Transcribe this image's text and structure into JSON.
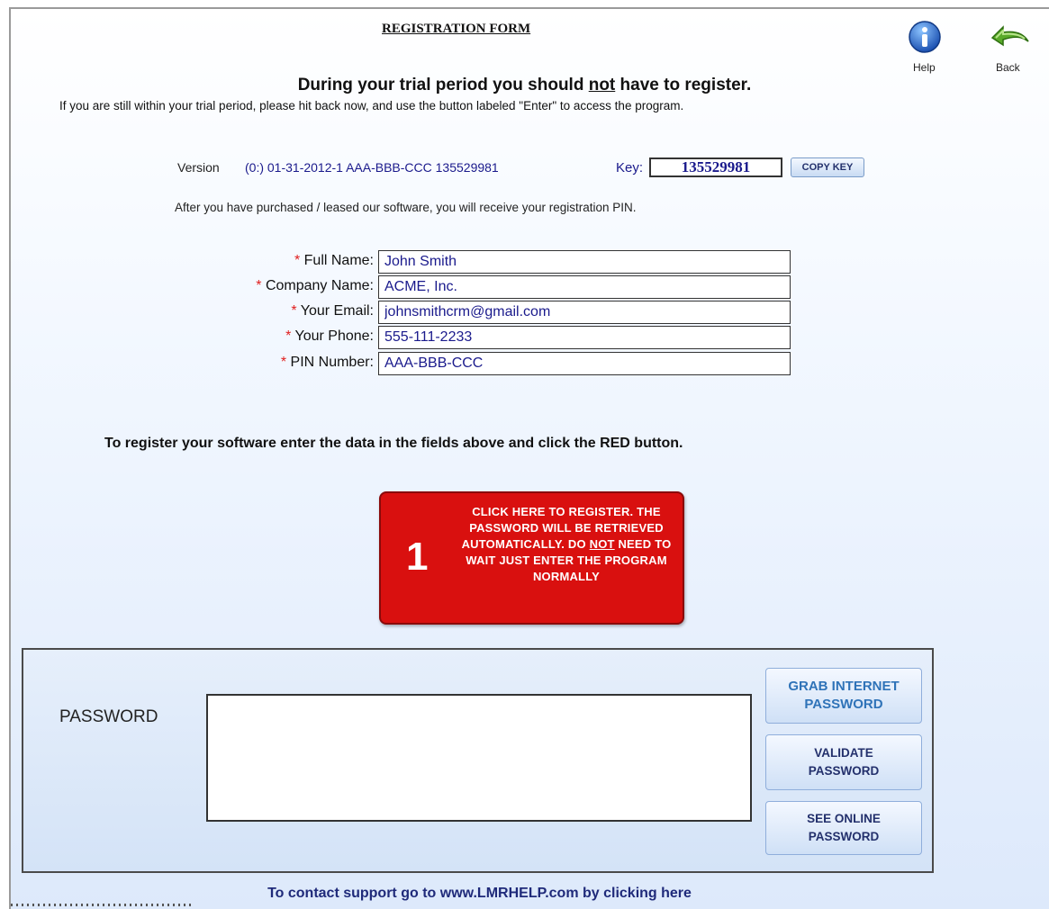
{
  "header": {
    "title": "REGISTRATION FORM",
    "help_label": "Help",
    "back_label": "Back",
    "help_icon": "info-circle-icon",
    "back_icon": "back-arrow-icon"
  },
  "intro": {
    "headline_pre": "During your trial period you should ",
    "headline_emph": "not",
    "headline_post": " have to register.",
    "subline": "If you are still within your trial period, please hit back now, and use the button labeled \"Enter\" to access the program."
  },
  "version": {
    "label": "Version",
    "value": "(0:) 01-31-2012-1 AAA-BBB-CCC 135529981",
    "key_label": "Key:",
    "key_value": "135529981",
    "copy_button": "COPY KEY"
  },
  "after_text": "After you have purchased / leased our software, you will receive your registration PIN.",
  "form": {
    "required_marker": "*",
    "fields": [
      {
        "label": "Full Name:",
        "value": "John Smith"
      },
      {
        "label": "Company Name:",
        "value": "ACME, Inc."
      },
      {
        "label": "Your Email:",
        "value": "johnsmithcrm@gmail.com"
      },
      {
        "label": "Your Phone:",
        "value": "555-111-2233"
      },
      {
        "label": "PIN Number:",
        "value": "AAA-BBB-CCC"
      }
    ]
  },
  "instruction": "To register your software enter the data in the fields above and click the RED button.",
  "register_button": {
    "number": "1",
    "line1": "CLICK HERE TO REGISTER. THE PASSWORD WILL BE RETRIEVED AUTOMATICALLY.",
    "do_word": "DO ",
    "not_word": "NOT",
    "line2": " NEED TO WAIT JUST ENTER THE PROGRAM NORMALLY",
    "color": "#d9100f"
  },
  "password_panel": {
    "label": "PASSWORD",
    "value": "",
    "grab_line1": "GRAB INTERNET",
    "grab_line2": "PASSWORD",
    "validate_line1": "VALIDATE",
    "validate_line2": "PASSWORD",
    "see_line1": "SEE ONLINE",
    "see_line2": "PASSWORD"
  },
  "footer": {
    "support_text": "To contact support go to www.LMRHELP.com by clicking here"
  }
}
